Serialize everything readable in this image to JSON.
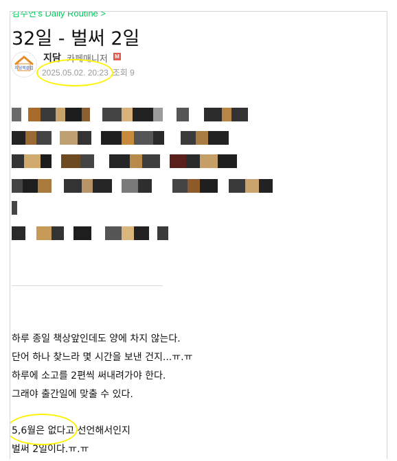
{
  "breadcrumb": "김주연's Daily Routine >",
  "post": {
    "title": "32일 - 벌써 2일",
    "author": "지담",
    "role": "카페매니저",
    "badge": "M",
    "date": "2025.05.02. 20:23",
    "views": "조회 9",
    "avatar_text": "지담북클럽"
  },
  "body_lines": [
    "하루 종일 책상앞인데도 양에 차지 않는다.",
    "단어 하나 찾느라 몇 시간을 보낸 건지...ㅠ.ㅠ",
    "하루에 소고를 2편씩 써내려가야 한다.",
    "그래야 출간일에 맞출 수 있다.",
    "5,6월은 없다고 선언해서인지",
    "벌써 2일이다.ㅠ.ㅠ"
  ],
  "colors": {
    "accent_green": "#03c75a",
    "highlight": "#fff200",
    "badge": "#e25a4e"
  },
  "icons": {
    "avatar": "house-logo-icon",
    "badge": "manager-badge-icon"
  }
}
